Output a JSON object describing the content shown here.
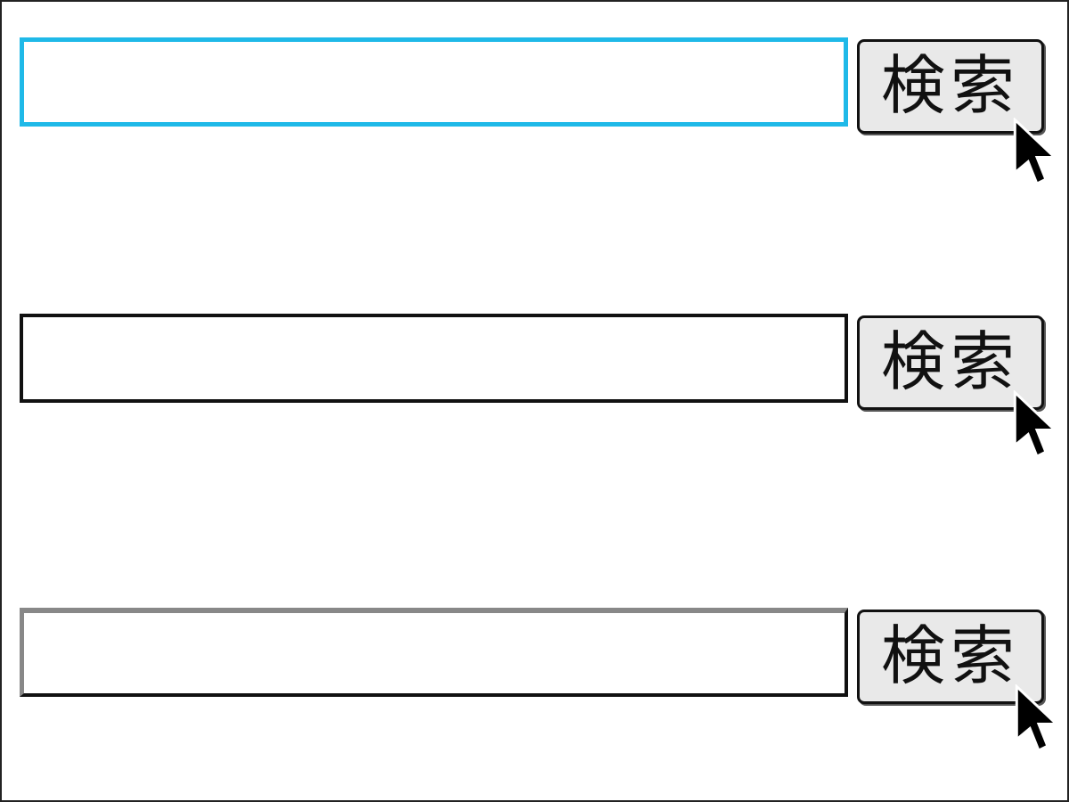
{
  "rows": [
    {
      "input_value": "",
      "button_label": "検索",
      "state": "focused"
    },
    {
      "input_value": "",
      "button_label": "検索",
      "state": "plain"
    },
    {
      "input_value": "",
      "button_label": "検索",
      "state": "inset"
    }
  ]
}
